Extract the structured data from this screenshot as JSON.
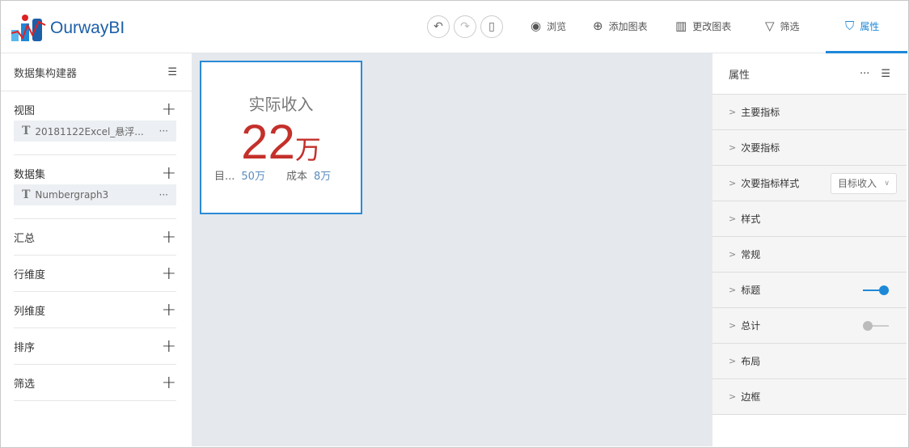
{
  "header": {
    "logo": "OurwayBI",
    "toolbar": [
      {
        "icon": "eye-icon",
        "label": "浏览"
      },
      {
        "icon": "plus-circle-icon",
        "label": "添加图表"
      },
      {
        "icon": "bar-chart-icon",
        "label": "更改图表"
      },
      {
        "icon": "filter-icon",
        "label": "筛选"
      },
      {
        "icon": "shirt-icon",
        "label": "属性"
      }
    ]
  },
  "left": {
    "title": "数据集构建器",
    "sections": [
      {
        "label": "视图",
        "item": "20181122Excel_悬浮..."
      },
      {
        "label": "数据集",
        "item": "Numbergraph3"
      },
      {
        "label": "汇总"
      },
      {
        "label": "行维度"
      },
      {
        "label": "列维度"
      },
      {
        "label": "排序"
      },
      {
        "label": "筛选"
      }
    ]
  },
  "card": {
    "title": "实际收入",
    "value": "22",
    "unit": "万",
    "sub": [
      {
        "label": "目...",
        "value": "50万"
      },
      {
        "label": "成本",
        "value": "8万"
      }
    ]
  },
  "right": {
    "title": "属性",
    "rows": [
      {
        "label": "主要指标"
      },
      {
        "label": "次要指标"
      },
      {
        "label": "次要指标样式",
        "select": "目标收入"
      },
      {
        "label": "样式"
      },
      {
        "label": "常规"
      },
      {
        "label": "标题",
        "toggle": true
      },
      {
        "label": "总计",
        "toggle": false
      },
      {
        "label": "布局"
      },
      {
        "label": "边框"
      }
    ]
  },
  "colors": {
    "accent": "#1e88d8",
    "value": "#c4302b"
  }
}
